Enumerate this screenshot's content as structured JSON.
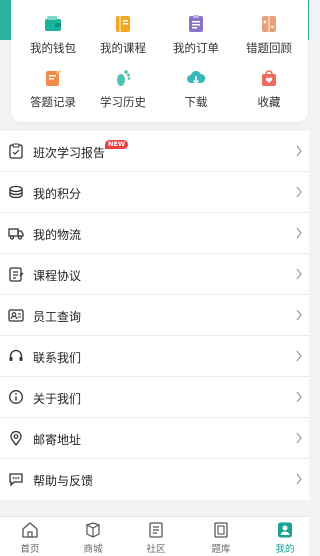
{
  "grid": [
    {
      "label": "我的钱包",
      "icon": "wallet-icon",
      "color": "#1bb39a"
    },
    {
      "label": "我的课程",
      "icon": "course-book-icon",
      "color": "#f5a623"
    },
    {
      "label": "我的订单",
      "icon": "order-list-icon",
      "color": "#8e74c9"
    },
    {
      "label": "错题回顾",
      "icon": "wrong-questions-icon",
      "color": "#e8a07a"
    },
    {
      "label": "答题记录",
      "icon": "answer-record-icon",
      "color": "#f08c4a"
    },
    {
      "label": "学习历史",
      "icon": "footprint-icon",
      "color": "#4cc2b0"
    },
    {
      "label": "下载",
      "icon": "cloud-download-icon",
      "color": "#3ab8b8"
    },
    {
      "label": "收藏",
      "icon": "favorite-bag-icon",
      "color": "#ef6a5a"
    }
  ],
  "menu": [
    {
      "label": "班次学习报告",
      "icon": "report-clipboard-icon",
      "badge": "NEW"
    },
    {
      "label": "我的积分",
      "icon": "points-coins-icon"
    },
    {
      "label": "我的物流",
      "icon": "delivery-truck-icon"
    },
    {
      "label": "课程协议",
      "icon": "agreement-doc-icon"
    },
    {
      "label": "员工查询",
      "icon": "employee-id-icon"
    },
    {
      "label": "联系我们",
      "icon": "headset-icon"
    },
    {
      "label": "关于我们",
      "icon": "info-icon"
    },
    {
      "label": "邮寄地址",
      "icon": "location-pin-icon"
    },
    {
      "label": "帮助与反馈",
      "icon": "feedback-chat-icon"
    }
  ],
  "tabs": [
    {
      "label": "首页",
      "icon": "home-icon"
    },
    {
      "label": "商城",
      "icon": "mall-icon"
    },
    {
      "label": "社区",
      "icon": "community-icon"
    },
    {
      "label": "题库",
      "icon": "question-bank-icon"
    },
    {
      "label": "我的",
      "icon": "profile-icon",
      "active": true
    }
  ],
  "colors": {
    "accent": "#1aa393",
    "badge": "#e8423f"
  }
}
